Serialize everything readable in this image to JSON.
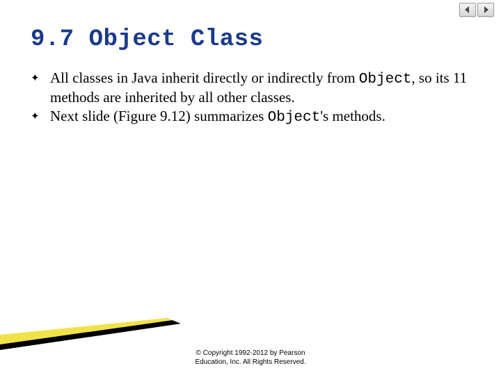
{
  "title": "9.7  Object Class",
  "bullets": [
    {
      "pre": "All classes in Java inherit directly or indirectly from ",
      "code": "Object",
      "post": ", so its 11 methods are inherited by all other classes."
    },
    {
      "pre": "Next slide (Figure 9.12) summarizes ",
      "code": "Object",
      "post": "'s methods."
    }
  ],
  "copyright": "© Copyright 1992-2012 by Pearson\nEducation, Inc. All Rights Reserved.",
  "nav": {
    "prev": "prev-slide",
    "next": "next-slide"
  }
}
